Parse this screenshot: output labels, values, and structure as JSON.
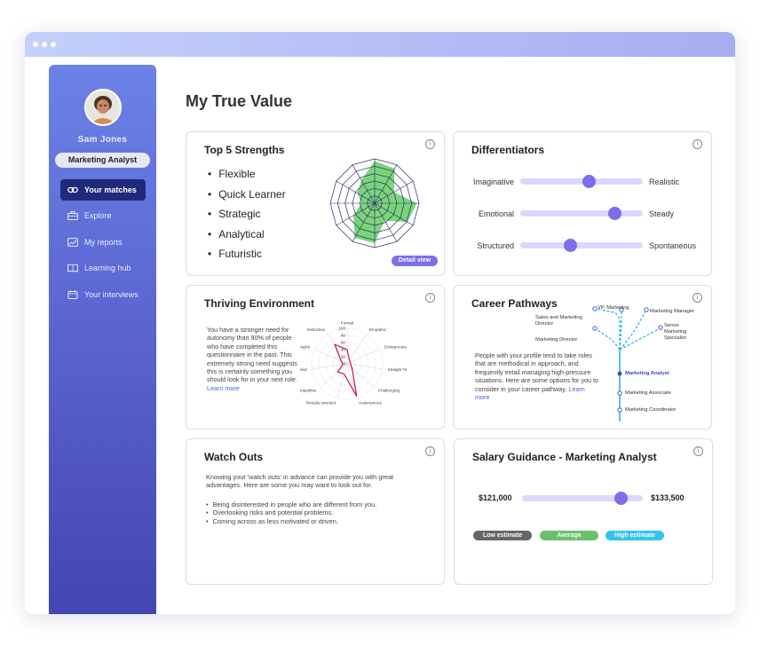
{
  "app": {
    "title": "My True Value"
  },
  "user": {
    "name": "Sam Jones",
    "role": "Marketing  Analyst"
  },
  "sidebar": {
    "items": [
      {
        "label": "Your matches",
        "icon": "link-icon",
        "active": true
      },
      {
        "label": "Explore",
        "icon": "briefcase-icon",
        "active": false
      },
      {
        "label": "My reports",
        "icon": "chart-icon",
        "active": false
      },
      {
        "label": "Learning hub",
        "icon": "book-icon",
        "active": false
      },
      {
        "label": "Your interviews",
        "icon": "calendar-icon",
        "active": false
      }
    ]
  },
  "strengths": {
    "title": "Top 5 Strengths",
    "items": [
      "Flexible",
      "Quick Learner",
      "Strategic",
      "Analytical",
      "Futuristic"
    ],
    "detail_label": "Detail view"
  },
  "differentiators": {
    "title": "Differentiators",
    "rows": [
      {
        "left": "Imaginative",
        "right": "Realistic",
        "value": 0.56
      },
      {
        "left": "Emotional",
        "right": "Steady",
        "value": 0.77
      },
      {
        "left": "Structured",
        "right": "Spontaneous",
        "value": 0.41
      }
    ]
  },
  "thriving": {
    "title": "Thriving Environment",
    "text": "You have a stronger need for autonomy than 90% of people who have completed this questionnaire in the past. This extremely strong need suggests this is certainly something you should look for in your next role.",
    "link": "Learn more",
    "radar": {
      "axes": [
        "Formal",
        "Empathic",
        "Entrepreneurial",
        "Straight Talking",
        "Challenging",
        "Autonomous",
        "Results oriented",
        "Competitive",
        "Principled",
        "Playful",
        "Instinctive"
      ],
      "ticks": [
        "100",
        "80",
        "60",
        "40",
        "20",
        "0"
      ],
      "values": [
        40,
        12,
        10,
        10,
        18,
        95,
        30,
        35,
        12,
        18,
        65
      ]
    }
  },
  "career": {
    "title": "Career Pathways",
    "text": "People with your profile tend to take roles that are methodical in approach, and frequently entail managing high-pressure situations. Here are some options for you to consider in your career pathway.",
    "link": "Learn more",
    "roles": {
      "vp": "VP, Marketing",
      "mm": "Marketing Manager",
      "smd": "Sales and Marketing Director",
      "smms": "Senior Marketing Specialist",
      "md": "Marketing Director",
      "ma": "Marketing Analyst",
      "mas": "Marketing Associate",
      "mc": "Marketing Coordinator"
    }
  },
  "watch": {
    "title": "Watch Outs",
    "intro": "Knowing your 'watch outs' in advance can provide you with great advantages. Here are some you may want to look out for.",
    "items": [
      "Being disinterested in people who are different from you.",
      "Overlooking risks and potential problems.",
      "Coming across as less motivated or driven."
    ]
  },
  "salary": {
    "title": "Salary Guidance - Marketing Analyst",
    "low": "$121,000",
    "high": "$133,500",
    "position": 0.82,
    "legend": [
      {
        "label": "Low estimate",
        "color": "#666666"
      },
      {
        "label": "Average",
        "color": "#6cbf6c"
      },
      {
        "label": "High estimate",
        "color": "#35c3ee"
      }
    ]
  },
  "colors": {
    "accent": "#7c6ee9",
    "track": "#dad9fb",
    "sidebar_top": "#6b82e6",
    "sidebar_bottom": "#4345b2"
  }
}
